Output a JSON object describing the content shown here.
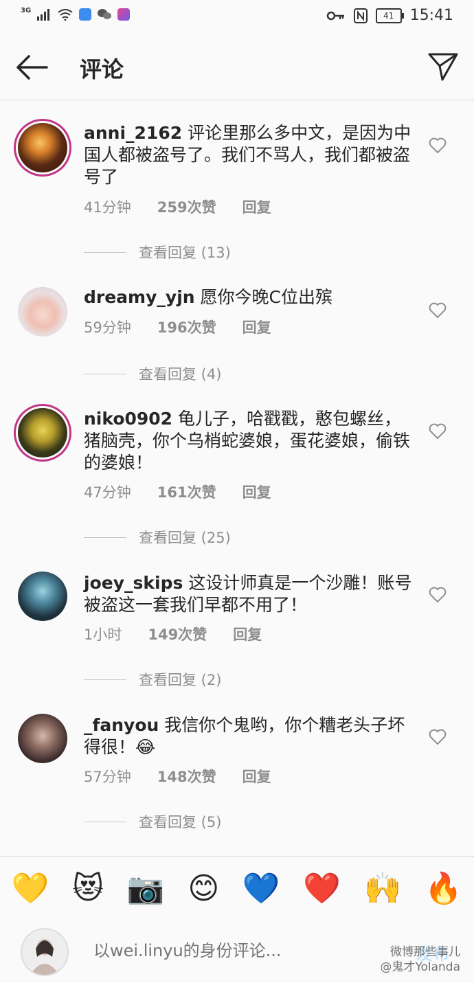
{
  "status_bar": {
    "network": "3G",
    "battery": "41",
    "time": "15:41"
  },
  "header": {
    "title": "评论"
  },
  "comments": [
    {
      "username": "anni_2162",
      "text": "评论里那么多中文，是因为中国人都被盗号了。我们不骂人，我们都被盗号了",
      "time": "41分钟",
      "likes": "259次赞",
      "reply": "回复",
      "view_replies": "查看回复 (13)"
    },
    {
      "username": "dreamy_yjn",
      "text": "愿你今晚C位出殡",
      "time": "59分钟",
      "likes": "196次赞",
      "reply": "回复",
      "view_replies": "查看回复 (4)"
    },
    {
      "username": "niko0902",
      "text": "龟儿子，哈戳戳，憨包螺丝，猪脑壳，你个乌梢蛇婆娘，蛋花婆娘，偷铁的婆娘！",
      "time": "47分钟",
      "likes": "161次赞",
      "reply": "回复",
      "view_replies": "查看回复 (25)"
    },
    {
      "username": "joey_skips",
      "text": "这设计师真是一个沙雕！账号被盗这一套我们早都不用了！",
      "time": "1小时",
      "likes": "149次赞",
      "reply": "回复",
      "view_replies": "查看回复 (2)"
    },
    {
      "username": "_fanyou",
      "text": "我信你个鬼哟，你个糟老头子坏得很！😂",
      "time": "57分钟",
      "likes": "148次赞",
      "reply": "回复",
      "view_replies": "查看回复 (5)"
    }
  ],
  "emojis": [
    "💛",
    "😻",
    "📷",
    "😊",
    "💙",
    "❤️",
    "🙌",
    "🔥"
  ],
  "composer": {
    "placeholder": "以wei.linyu的身份评论...",
    "post_label": "发布"
  },
  "watermark": {
    "line1": "微博那些事儿",
    "line2": "@鬼才Yolanda"
  },
  "colors": {
    "background": "#fafafa",
    "text": "#262626",
    "secondary_text": "#8e8e8e",
    "post_button_disabled": "#b2dffc",
    "story_ring": "#c13584"
  }
}
